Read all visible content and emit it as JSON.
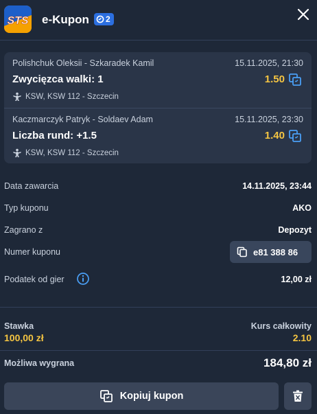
{
  "header": {
    "logo_text": "STS",
    "title": "e-Kupon",
    "bet_count": "2"
  },
  "bets": [
    {
      "players": "Polishchuk Oleksii - Szkaradek Kamil",
      "date": "15.11.2025, 21:30",
      "market": "Zwycięzca walki: 1",
      "odds": "1.50",
      "league": "KSW, KSW 112 - Szczecin"
    },
    {
      "players": "Kaczmarczyk Patryk - Soldaev Adam",
      "date": "15.11.2025, 23:30",
      "market": "Liczba rund: +1.5",
      "odds": "1.40",
      "league": "KSW, KSW 112 - Szczecin"
    }
  ],
  "details": {
    "date_label": "Data zawarcia",
    "date_value": "14.11.2025, 23:44",
    "type_label": "Typ kuponu",
    "type_value": "AKO",
    "played_label": "Zagrano z",
    "played_value": "Depozyt",
    "number_label": "Numer kuponu",
    "number_value": "e81 388 86",
    "tax_label": "Podatek od gier",
    "tax_value": "12,00 zł"
  },
  "summary": {
    "stake_label": "Stawka",
    "stake_value": "100,00 zł",
    "total_odds_label": "Kurs całkowity",
    "total_odds_value": "2.10",
    "win_label": "Możliwa wygrana",
    "win_value": "184,80 zł"
  },
  "actions": {
    "copy_label": "Kopiuj kupon"
  },
  "colors": {
    "background": "#1e2838",
    "card": "#2a3548",
    "accent_yellow": "#f5c542",
    "badge_blue": "#2c6fe0",
    "icon_blue": "#4a9ff5"
  }
}
